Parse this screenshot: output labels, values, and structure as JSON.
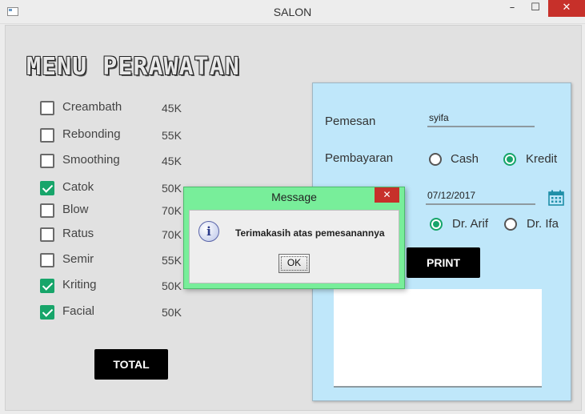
{
  "window": {
    "title": "SALON",
    "minimize_glyph": "–",
    "maximize_glyph": "☐",
    "close_glyph": "✕"
  },
  "menu": {
    "title": "MENU PERAWATAN",
    "items": [
      {
        "label": "Creambath",
        "price": "45K",
        "checked": false
      },
      {
        "label": "Rebonding",
        "price": "55K",
        "checked": false
      },
      {
        "label": "Smoothing",
        "price": "45K",
        "checked": false
      },
      {
        "label": "Catok",
        "price": "50K",
        "checked": true
      },
      {
        "label": "Blow",
        "price": "70K",
        "checked": false
      },
      {
        "label": "Ratus",
        "price": "70K",
        "checked": false
      },
      {
        "label": "Semir",
        "price": "55K",
        "checked": false
      },
      {
        "label": "Kriting",
        "price": "50K",
        "checked": true
      },
      {
        "label": "Facial",
        "price": "50K",
        "checked": true
      }
    ],
    "total_button": "TOTAL"
  },
  "form": {
    "pemesan_label": "Pemesan",
    "pemesan_value": "syifa",
    "pembayaran_label": "Pembayaran",
    "payment_options": [
      {
        "label": "Cash",
        "selected": false
      },
      {
        "label": "Kredit",
        "selected": true
      }
    ],
    "date_value": "07/12/2017",
    "doctor_options": [
      {
        "label": "Dr. Arif",
        "selected": true
      },
      {
        "label": "Dr. Ifa",
        "selected": false
      }
    ],
    "print_button": "PRINT",
    "accent_color": "#17a56a",
    "panel_color": "#bfe7fa"
  },
  "dialog": {
    "title": "Message",
    "close_glyph": "✕",
    "icon_glyph": "i",
    "message": "Terimakasih atas pemesanannya",
    "ok_label": "OK",
    "title_color": "#78ee9a"
  }
}
